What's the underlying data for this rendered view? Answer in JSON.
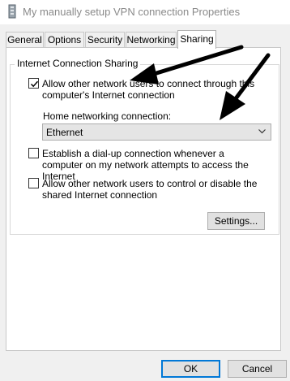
{
  "window": {
    "title": "My manually setup VPN connection Properties",
    "icon": "network-connection-icon"
  },
  "tabs": [
    {
      "label": "General",
      "active": false
    },
    {
      "label": "Options",
      "active": false
    },
    {
      "label": "Security",
      "active": false
    },
    {
      "label": "Networking",
      "active": false
    },
    {
      "label": "Sharing",
      "active": true
    }
  ],
  "sharing": {
    "group_label": "Internet Connection Sharing",
    "allow_connect": {
      "checked": true,
      "label": "Allow other network users to connect through this computer's Internet connection"
    },
    "home_networking": {
      "label": "Home networking connection:",
      "value": "Ethernet"
    },
    "dialup": {
      "checked": false,
      "label": "Establish a dial-up connection whenever a computer on my network attempts to access the Internet"
    },
    "allow_control": {
      "checked": false,
      "label": "Allow other network users to control or disable the shared Internet connection"
    },
    "settings_button": "Settings..."
  },
  "footer": {
    "ok_label": "OK",
    "cancel_label": "Cancel"
  },
  "colors": {
    "window_bg": "#f0f0f0",
    "panel_bg": "#ffffff",
    "button_bg": "#e1e1e1",
    "accent": "#0078d7",
    "annotation_arrow": "#000000"
  }
}
